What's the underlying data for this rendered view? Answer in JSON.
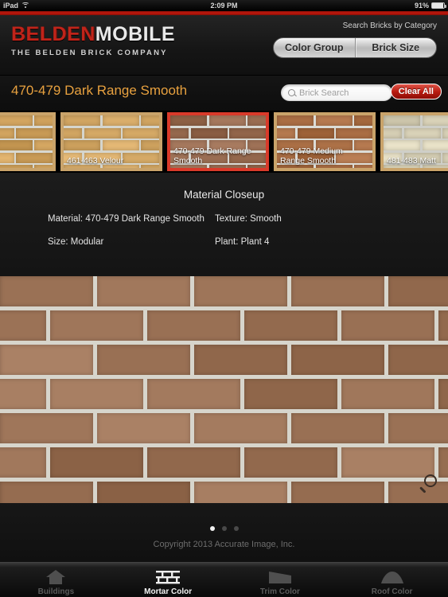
{
  "statusbar": {
    "device": "iPad",
    "wifi_icon": "wifi-icon",
    "time": "2:09 PM",
    "battery_percent": "91%",
    "battery_level": 91
  },
  "header": {
    "logo_primary": "BELDEN",
    "logo_secondary": "MOBILE",
    "logo_tagline": "THE BELDEN BRICK COMPANY",
    "category_label": "Search Bricks by Category",
    "segmented": [
      {
        "label": "Color Group",
        "selected": false
      },
      {
        "label": "Brick Size",
        "selected": false
      }
    ]
  },
  "title_row": {
    "title": "470-479 Dark Range Smooth",
    "search": {
      "value": "",
      "placeholder": "Brick Search",
      "icon": "search-icon"
    },
    "clear_all_label": "Clear All"
  },
  "thumbnails": [
    {
      "label": "",
      "selected": false,
      "brick": "#d2a45f",
      "mortar": "#d8d8d0",
      "partial": true
    },
    {
      "label": "461-463 Velour",
      "selected": false,
      "brick": "#d7ab68",
      "mortar": "#d5d5cd",
      "partial": false
    },
    {
      "label": "470-479 Dark Range Smooth",
      "selected": true,
      "brick": "#9a6d52",
      "mortar": "#d9d9d4",
      "partial": false
    },
    {
      "label": "470-479 Medium Range Smooth",
      "selected": false,
      "brick": "#ab6f45",
      "mortar": "#dcdcd6",
      "partial": false
    },
    {
      "label": "481-483 Matt",
      "selected": false,
      "brick": "#ddd6bc",
      "mortar": "#cfcfc8",
      "partial": false
    }
  ],
  "closeup": {
    "heading": "Material Closeup",
    "specs": [
      {
        "label": "Material:",
        "value": "470-479 Dark Range Smooth"
      },
      {
        "label": "Texture:",
        "value": "Smooth"
      },
      {
        "label": "Size:",
        "value": "Modular"
      },
      {
        "label": "Plant:",
        "value": "Plant 4"
      }
    ]
  },
  "main_image": {
    "alt": "470-479 Dark Range Smooth brick wall closeup",
    "brick_color": "#9b7256",
    "mortar_color": "#d7d5cc",
    "zoom_icon": "magnifier-icon"
  },
  "footer": {
    "page_dots": 3,
    "active_dot": 0,
    "copyright": "Copyright 2013 Accurate Image, Inc."
  },
  "tabbar": [
    {
      "label": "Buildings",
      "icon": "house-icon",
      "active": false
    },
    {
      "label": "Mortar Color",
      "icon": "brick-wall-icon",
      "active": true
    },
    {
      "label": "Trim Color",
      "icon": "trim-icon",
      "active": false
    },
    {
      "label": "Roof Color",
      "icon": "roof-icon",
      "active": false
    }
  ],
  "colors": {
    "accent_red": "#c0180c",
    "title_orange": "#e8a13f",
    "selected_border": "#d93a2a"
  }
}
